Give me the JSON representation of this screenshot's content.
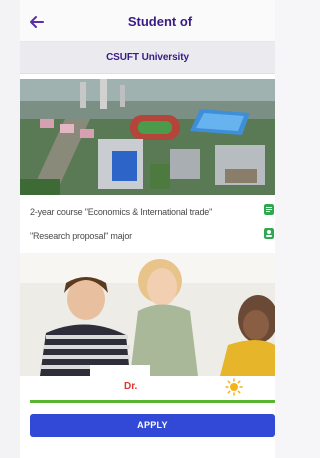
{
  "header": {
    "title": "Student of",
    "subtitle": "CSUFT University",
    "back_icon": "arrow-left-icon",
    "accent": "#3a1b86"
  },
  "program": {
    "course": "2-year course \"Economics & International trade\"",
    "major": "\"Research proposal\" major",
    "course_icon": "document-icon",
    "major_icon": "person-badge-icon",
    "icon_color": "#2fa84f"
  },
  "images": {
    "campus": "campus-aerial-photo",
    "students": "students-group-photo"
  },
  "status": {
    "degree": "Dr.",
    "degree_color": "#e0362f",
    "weather_icon": "sun-icon",
    "progress": 1.0,
    "progress_color": "#58b530"
  },
  "actions": {
    "apply_label": "APPLY",
    "apply_color": "#3149d6"
  }
}
